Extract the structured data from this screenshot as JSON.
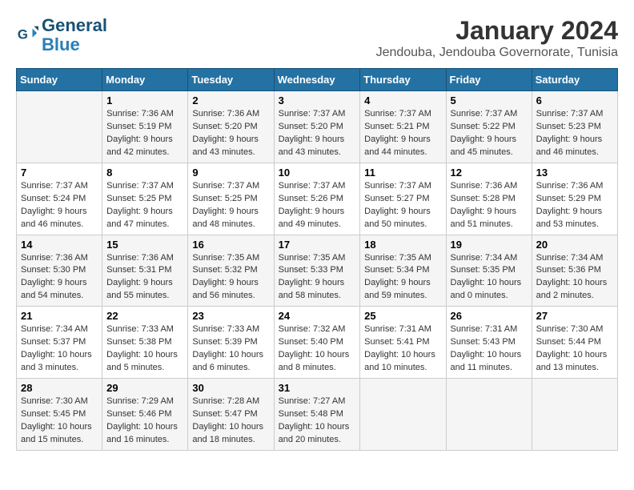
{
  "logo": {
    "line1": "General",
    "line2": "Blue"
  },
  "title": "January 2024",
  "subtitle": "Jendouba, Jendouba Governorate, Tunisia",
  "weekdays": [
    "Sunday",
    "Monday",
    "Tuesday",
    "Wednesday",
    "Thursday",
    "Friday",
    "Saturday"
  ],
  "weeks": [
    [
      {
        "day": "",
        "info": ""
      },
      {
        "day": "1",
        "info": "Sunrise: 7:36 AM\nSunset: 5:19 PM\nDaylight: 9 hours\nand 42 minutes."
      },
      {
        "day": "2",
        "info": "Sunrise: 7:36 AM\nSunset: 5:20 PM\nDaylight: 9 hours\nand 43 minutes."
      },
      {
        "day": "3",
        "info": "Sunrise: 7:37 AM\nSunset: 5:20 PM\nDaylight: 9 hours\nand 43 minutes."
      },
      {
        "day": "4",
        "info": "Sunrise: 7:37 AM\nSunset: 5:21 PM\nDaylight: 9 hours\nand 44 minutes."
      },
      {
        "day": "5",
        "info": "Sunrise: 7:37 AM\nSunset: 5:22 PM\nDaylight: 9 hours\nand 45 minutes."
      },
      {
        "day": "6",
        "info": "Sunrise: 7:37 AM\nSunset: 5:23 PM\nDaylight: 9 hours\nand 46 minutes."
      }
    ],
    [
      {
        "day": "7",
        "info": "Sunrise: 7:37 AM\nSunset: 5:24 PM\nDaylight: 9 hours\nand 46 minutes."
      },
      {
        "day": "8",
        "info": "Sunrise: 7:37 AM\nSunset: 5:25 PM\nDaylight: 9 hours\nand 47 minutes."
      },
      {
        "day": "9",
        "info": "Sunrise: 7:37 AM\nSunset: 5:25 PM\nDaylight: 9 hours\nand 48 minutes."
      },
      {
        "day": "10",
        "info": "Sunrise: 7:37 AM\nSunset: 5:26 PM\nDaylight: 9 hours\nand 49 minutes."
      },
      {
        "day": "11",
        "info": "Sunrise: 7:37 AM\nSunset: 5:27 PM\nDaylight: 9 hours\nand 50 minutes."
      },
      {
        "day": "12",
        "info": "Sunrise: 7:36 AM\nSunset: 5:28 PM\nDaylight: 9 hours\nand 51 minutes."
      },
      {
        "day": "13",
        "info": "Sunrise: 7:36 AM\nSunset: 5:29 PM\nDaylight: 9 hours\nand 53 minutes."
      }
    ],
    [
      {
        "day": "14",
        "info": "Sunrise: 7:36 AM\nSunset: 5:30 PM\nDaylight: 9 hours\nand 54 minutes."
      },
      {
        "day": "15",
        "info": "Sunrise: 7:36 AM\nSunset: 5:31 PM\nDaylight: 9 hours\nand 55 minutes."
      },
      {
        "day": "16",
        "info": "Sunrise: 7:35 AM\nSunset: 5:32 PM\nDaylight: 9 hours\nand 56 minutes."
      },
      {
        "day": "17",
        "info": "Sunrise: 7:35 AM\nSunset: 5:33 PM\nDaylight: 9 hours\nand 58 minutes."
      },
      {
        "day": "18",
        "info": "Sunrise: 7:35 AM\nSunset: 5:34 PM\nDaylight: 9 hours\nand 59 minutes."
      },
      {
        "day": "19",
        "info": "Sunrise: 7:34 AM\nSunset: 5:35 PM\nDaylight: 10 hours\nand 0 minutes."
      },
      {
        "day": "20",
        "info": "Sunrise: 7:34 AM\nSunset: 5:36 PM\nDaylight: 10 hours\nand 2 minutes."
      }
    ],
    [
      {
        "day": "21",
        "info": "Sunrise: 7:34 AM\nSunset: 5:37 PM\nDaylight: 10 hours\nand 3 minutes."
      },
      {
        "day": "22",
        "info": "Sunrise: 7:33 AM\nSunset: 5:38 PM\nDaylight: 10 hours\nand 5 minutes."
      },
      {
        "day": "23",
        "info": "Sunrise: 7:33 AM\nSunset: 5:39 PM\nDaylight: 10 hours\nand 6 minutes."
      },
      {
        "day": "24",
        "info": "Sunrise: 7:32 AM\nSunset: 5:40 PM\nDaylight: 10 hours\nand 8 minutes."
      },
      {
        "day": "25",
        "info": "Sunrise: 7:31 AM\nSunset: 5:41 PM\nDaylight: 10 hours\nand 10 minutes."
      },
      {
        "day": "26",
        "info": "Sunrise: 7:31 AM\nSunset: 5:43 PM\nDaylight: 10 hours\nand 11 minutes."
      },
      {
        "day": "27",
        "info": "Sunrise: 7:30 AM\nSunset: 5:44 PM\nDaylight: 10 hours\nand 13 minutes."
      }
    ],
    [
      {
        "day": "28",
        "info": "Sunrise: 7:30 AM\nSunset: 5:45 PM\nDaylight: 10 hours\nand 15 minutes."
      },
      {
        "day": "29",
        "info": "Sunrise: 7:29 AM\nSunset: 5:46 PM\nDaylight: 10 hours\nand 16 minutes."
      },
      {
        "day": "30",
        "info": "Sunrise: 7:28 AM\nSunset: 5:47 PM\nDaylight: 10 hours\nand 18 minutes."
      },
      {
        "day": "31",
        "info": "Sunrise: 7:27 AM\nSunset: 5:48 PM\nDaylight: 10 hours\nand 20 minutes."
      },
      {
        "day": "",
        "info": ""
      },
      {
        "day": "",
        "info": ""
      },
      {
        "day": "",
        "info": ""
      }
    ]
  ]
}
